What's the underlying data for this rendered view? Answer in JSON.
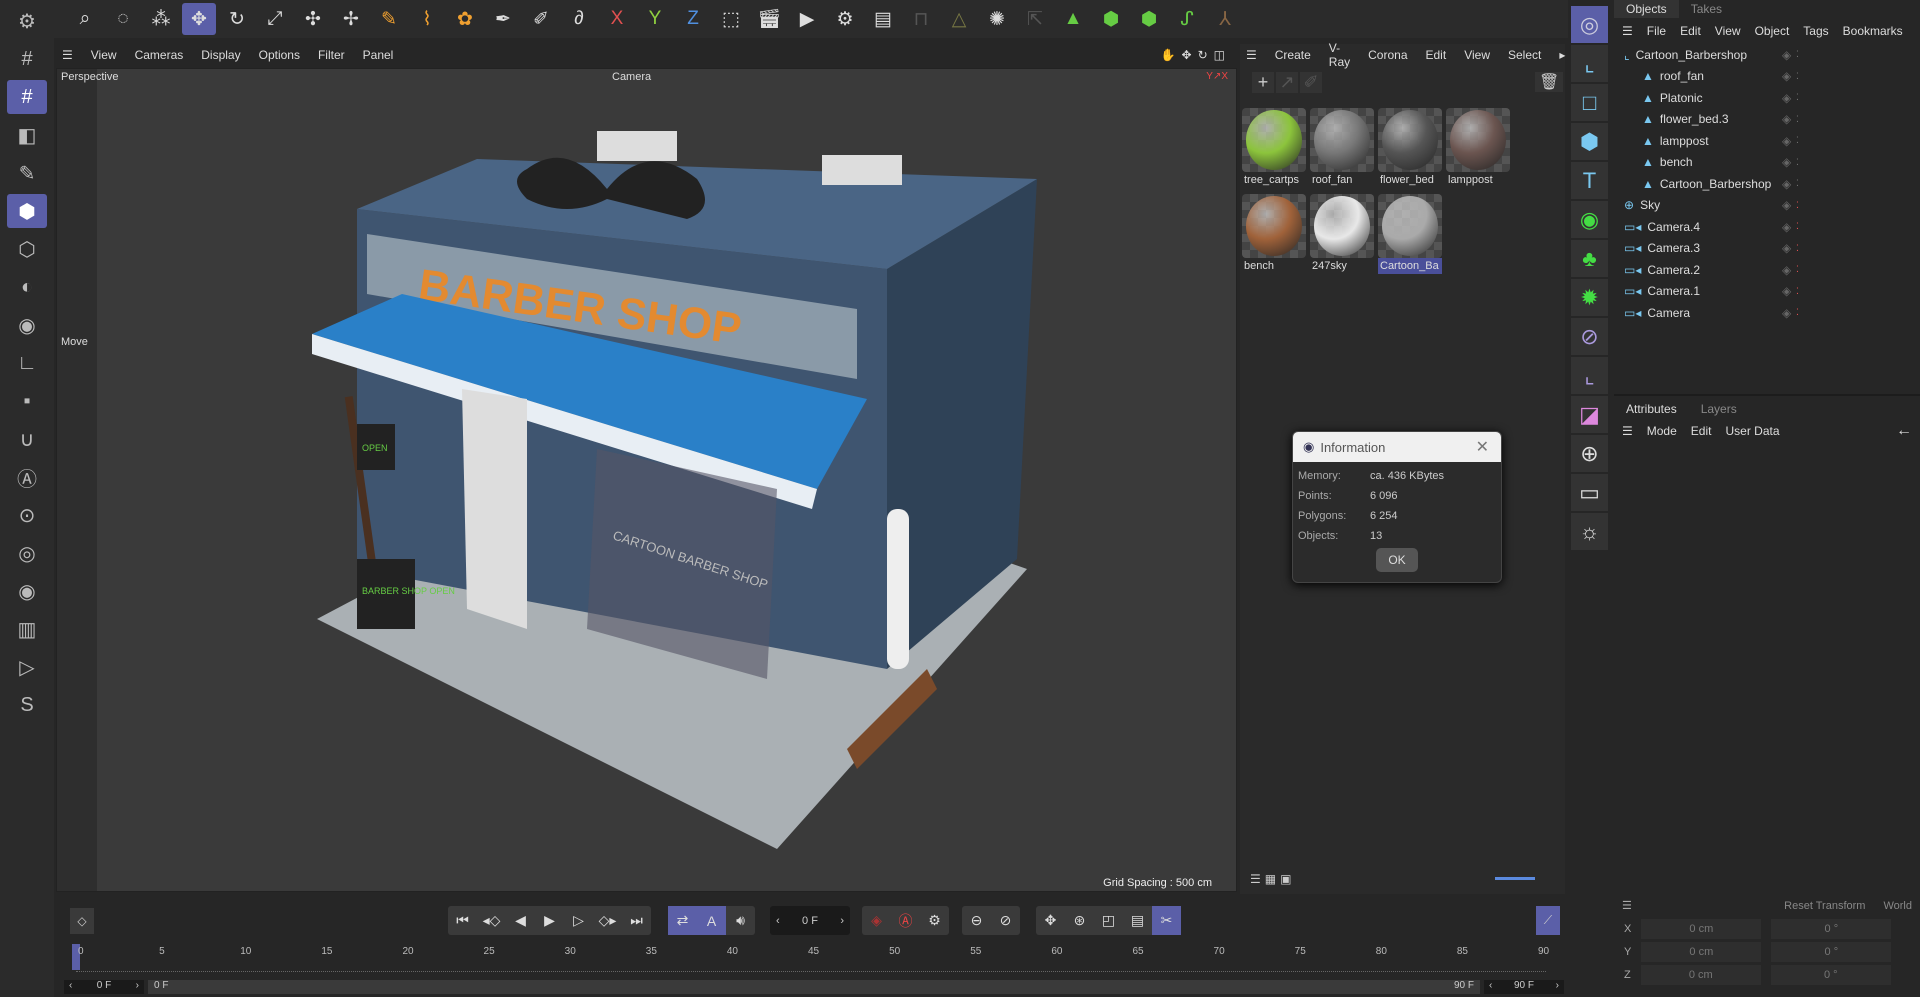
{
  "viewport": {
    "menu": [
      "View",
      "Cameras",
      "Display",
      "Options",
      "Filter",
      "Panel"
    ],
    "label": "Perspective",
    "camera": "Camera",
    "tool": "Move",
    "grid": "Grid Spacing : 500 cm",
    "sign_text": "BARBER SHOP",
    "window_text": "CARTOON BARBER SHOP",
    "board_text": "BARBER SHOP OPEN",
    "open_sign": "OPEN"
  },
  "materials": {
    "menu": [
      "Create",
      "V-Ray",
      "Corona",
      "Edit",
      "View",
      "Select"
    ],
    "items": [
      {
        "name": "tree_cartps",
        "color": "#8cc43c"
      },
      {
        "name": "roof_fan",
        "color": "#777"
      },
      {
        "name": "flower_bed",
        "color": "#555"
      },
      {
        "name": "lamppost",
        "color": "#6b5550"
      },
      {
        "name": "bench",
        "color": "#a0623a"
      },
      {
        "name": "247sky",
        "color": "#e8e8e8"
      },
      {
        "name": "Cartoon_Ba",
        "color": "#aaa"
      }
    ],
    "selected": "Cartoon_Ba"
  },
  "objects": {
    "tabs": [
      "Objects",
      "Takes"
    ],
    "menu": [
      "File",
      "Edit",
      "View",
      "Object",
      "Tags",
      "Bookmarks"
    ],
    "items": [
      {
        "name": "Cartoon_Barbershop",
        "level": 0,
        "icon": "null-icon"
      },
      {
        "name": "roof_fan",
        "level": 1,
        "icon": "polygon-icon"
      },
      {
        "name": "Platonic",
        "level": 1,
        "icon": "polygon-icon"
      },
      {
        "name": "flower_bed.3",
        "level": 1,
        "icon": "polygon-icon"
      },
      {
        "name": "lamppost",
        "level": 1,
        "icon": "polygon-icon"
      },
      {
        "name": "bench",
        "level": 1,
        "icon": "polygon-icon"
      },
      {
        "name": "Cartoon_Barbershop",
        "level": 1,
        "icon": "polygon-icon"
      },
      {
        "name": "Sky",
        "level": 0,
        "icon": "sky-icon"
      },
      {
        "name": "Camera.4",
        "level": 0,
        "icon": "camera-icon"
      },
      {
        "name": "Camera.3",
        "level": 0,
        "icon": "camera-icon"
      },
      {
        "name": "Camera.2",
        "level": 0,
        "icon": "camera-icon"
      },
      {
        "name": "Camera.1",
        "level": 0,
        "icon": "camera-icon"
      },
      {
        "name": "Camera",
        "level": 0,
        "icon": "camera-icon"
      }
    ]
  },
  "attributes": {
    "tabs": [
      "Attributes",
      "Layers"
    ],
    "menu": [
      "Mode",
      "Edit",
      "User Data"
    ]
  },
  "dialog": {
    "title": "Information",
    "rows": [
      {
        "label": "Memory:",
        "value": "ca. 436 KBytes"
      },
      {
        "label": "Points:",
        "value": "6 096"
      },
      {
        "label": "Polygons:",
        "value": "6 254"
      },
      {
        "label": "Objects:",
        "value": "13"
      }
    ],
    "ok": "OK"
  },
  "timeline": {
    "current": "0 F",
    "ticks": [
      "0",
      "5",
      "10",
      "15",
      "20",
      "25",
      "30",
      "35",
      "40",
      "45",
      "50",
      "55",
      "60",
      "65",
      "70",
      "75",
      "80",
      "85",
      "90"
    ],
    "start": "0 F",
    "range_start": "0 F",
    "range_end": "90 F",
    "end": "90 F"
  },
  "coords": {
    "reset": "Reset Transform",
    "world": "World",
    "rows": [
      {
        "axis": "X",
        "pos": "0 cm",
        "rot": "0 °"
      },
      {
        "axis": "Y",
        "pos": "0 cm",
        "rot": "0 °"
      },
      {
        "axis": "Z",
        "pos": "0 cm",
        "rot": "0 °"
      }
    ]
  },
  "toolbar": {
    "axis_x": "X",
    "axis_y": "Y",
    "axis_z": "Z"
  }
}
